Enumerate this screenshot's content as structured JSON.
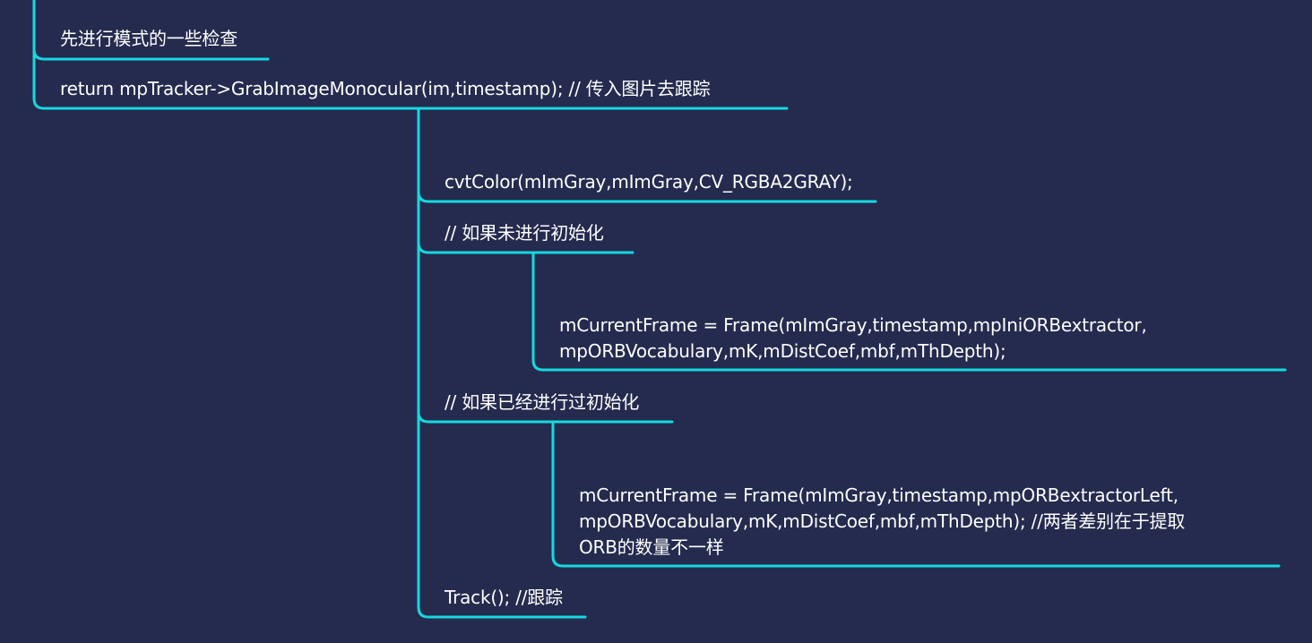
{
  "colors": {
    "background": "#252b4e",
    "connector": "#16d8e0",
    "text": "#ffffff"
  },
  "nodes": {
    "mode_check": "先进行模式的一些检查",
    "return_grab": "return mpTracker->GrabImageMonocular(im,timestamp);  // 传入图片去跟踪",
    "cvt_color": "cvtColor(mImGray,mImGray,CV_RGBA2GRAY);",
    "if_not_init": "// 如果未进行初始化",
    "frame_ini_line1": "mCurrentFrame = Frame(mImGray,timestamp,mpIniORBextractor,",
    "frame_ini_line2": "mpORBVocabulary,mK,mDistCoef,mbf,mThDepth);",
    "if_init": "// 如果已经进行过初始化",
    "frame_left_line1": "mCurrentFrame = Frame(mImGray,timestamp,mpORBextractorLeft,",
    "frame_left_line2": "mpORBVocabulary,mK,mDistCoef,mbf,mThDepth);  //两者差别在于提取",
    "frame_left_line3": "ORB的数量不一样",
    "track": "Track();  //跟踪"
  }
}
